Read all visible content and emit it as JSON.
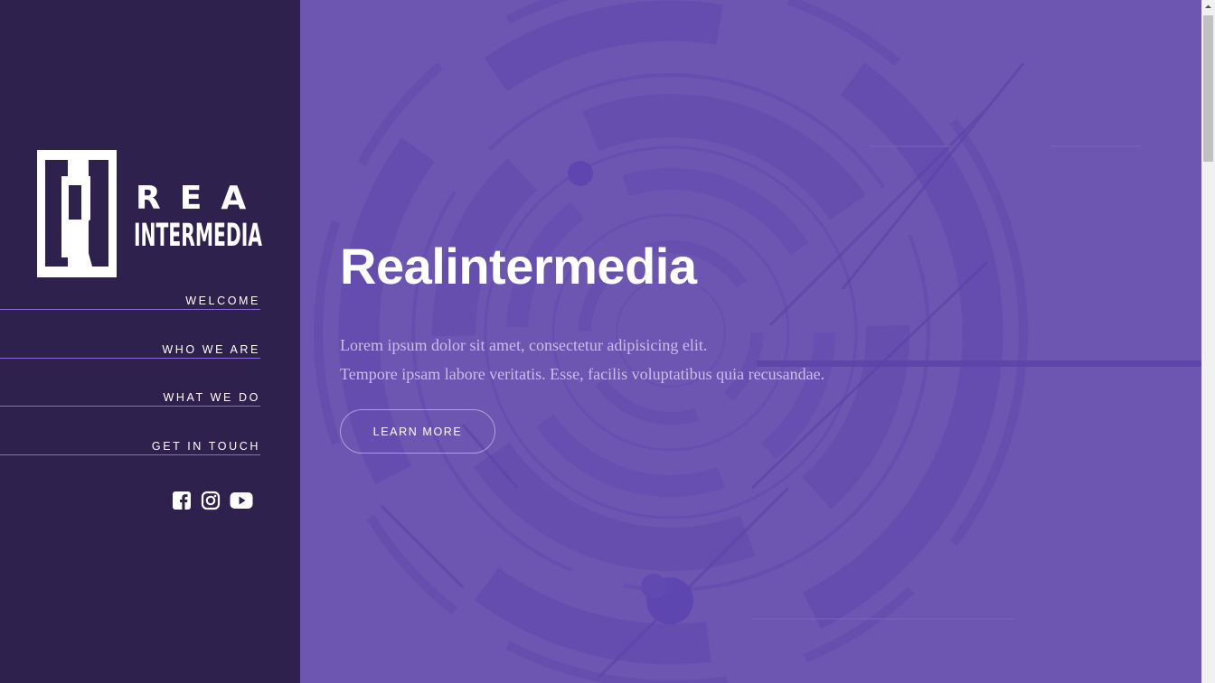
{
  "brand": {
    "top": "REAL",
    "bottom": "INTERMEDIA"
  },
  "nav": [
    {
      "label": "WELCOME"
    },
    {
      "label": "WHO WE ARE"
    },
    {
      "label": "WHAT WE DO"
    },
    {
      "label": "GET IN TOUCH"
    }
  ],
  "socials": [
    {
      "icon": "facebook-icon"
    },
    {
      "icon": "instagram-icon"
    },
    {
      "icon": "youtube-icon"
    }
  ],
  "hero": {
    "title": "Realintermedia",
    "line1": "Lorem ipsum dolor sit amet, consectetur adipisicing elit.",
    "line2": "Tempore ipsam labore veritatis. Esse, facilis voluptatibus quia recusandae.",
    "cta": "LEARN MORE"
  },
  "colors": {
    "sidebar_bg": "#2f214d",
    "hero_bg": "#6d55b2",
    "accent_line": "#8a6ad6",
    "text_muted": "#cbbde8"
  }
}
